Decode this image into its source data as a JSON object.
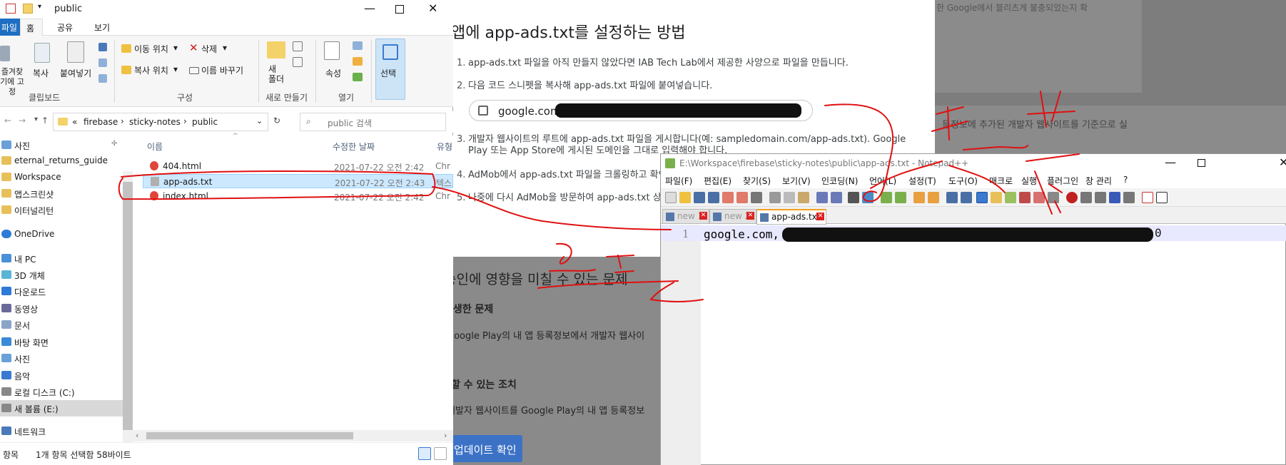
{
  "background_page": {
    "top_right_text": "한 Google에서 블리츠게 불충되었는지 확",
    "card2_text": "등정보에 추가된 개발자 웹사이트를 기준으로 실",
    "title": "앱에 app-ads.txt를 설정하는 방법",
    "steps": [
      {
        "num": "1.",
        "text": "app-ads.txt 파일을 아직 만들지 않았다면 IAB Tech Lab에서 제공한 사양으로 파일을 만듭니다."
      },
      {
        "num": "2.",
        "text": "다음 코드 스니펫을 복사해 app-ads.txt 파일에 붙여넣습니다."
      },
      {
        "num": "3.",
        "text": "개발자 웹사이트의 루트에 app-ads.txt 파일을 게시합니다(예: sampledomain.com/app-ads.txt). Google"
      },
      {
        "num": "",
        "text": "Play 또는 App Store에 게시된 도메인을 그대로 입력해야 합니다."
      },
      {
        "num": "4.",
        "text": "AdMob에서 app-ads.txt 파일을 크롤링하고 확인"
      },
      {
        "num": "5.",
        "text": "나중에 다시 AdMob을 방문하여 app-ads.txt 상태"
      }
    ],
    "snippet_text": "google.com,",
    "issues_heading": "승인에 영향을 미칠 수 있는 문제",
    "occurred_label": "발생한 문제",
    "occurred_text": "Google Play의 내 앱 등록정보에서 개발자 웹사이",
    "action_label": "할 수 있는 조치",
    "action_text": "개발자 웹사이트를 Google Play의 내 앱 등록정보",
    "update_button": "업데이트 확인"
  },
  "explorer": {
    "title": "public",
    "tabs": [
      "파일",
      "홈",
      "공유",
      "보기"
    ],
    "ribbon": {
      "pin_label": "즐겨찾기에 고정",
      "copy": "복사",
      "paste": "붙여넣기",
      "group_clipboard": "클립보드",
      "move_to": "이동 위치",
      "copy_to": "복사 위치",
      "delete": "삭제",
      "rename": "이름 바꾸기",
      "group_organize": "구성",
      "new_folder": "새 폴더",
      "group_new": "새로 만들기",
      "properties": "속성",
      "group_open": "열기",
      "select": "선택"
    },
    "breadcrumb": [
      "«",
      "firebase",
      "›",
      "sticky-notes",
      "›",
      "public"
    ],
    "search_placeholder": "public 검색",
    "nav_items": [
      {
        "label": "사진",
        "color": "#6aa0d8"
      },
      {
        "label": "eternal_returns_guide",
        "color": "#e8c05a"
      },
      {
        "label": "Workspace",
        "color": "#e8c05a"
      },
      {
        "label": "앱스크린샷",
        "color": "#e8c05a"
      },
      {
        "label": "이터널리턴",
        "color": "#e8c05a"
      },
      {
        "label": "OneDrive",
        "color": "#2d7bd6"
      },
      {
        "label": "내 PC",
        "color": "#4a90d9"
      },
      {
        "label": "3D 개체",
        "color": "#5ab4d6"
      },
      {
        "label": "다운로드",
        "color": "#2d7bd6"
      },
      {
        "label": "동영상",
        "color": "#6a6a9a"
      },
      {
        "label": "문서",
        "color": "#8aa4c8"
      },
      {
        "label": "바탕 화면",
        "color": "#3a8ad8"
      },
      {
        "label": "사진",
        "color": "#6aa0d8"
      },
      {
        "label": "음악",
        "color": "#3a7ad0"
      },
      {
        "label": "로컬 디스크 (C:)",
        "color": "#888888"
      },
      {
        "label": "새 볼륨 (E:)",
        "color": "#888888"
      },
      {
        "label": "네트워크",
        "color": "#4a7ab8"
      }
    ],
    "columns": [
      "이름",
      "수정한 날짜",
      "유형"
    ],
    "files": [
      {
        "name": "404.html",
        "date": "2021-07-22 오전 2:42",
        "type": "Chr",
        "icon_color": "#e0453a",
        "selected": false
      },
      {
        "name": "app-ads.txt",
        "date": "2021-07-22 오전 2:43",
        "type": "텍스",
        "icon_color": "#b0b0b0",
        "selected": true
      },
      {
        "name": "index.html",
        "date": "2021-07-22 오전 2:42",
        "type": "Chr",
        "icon_color": "#e0453a",
        "selected": false
      }
    ],
    "status_left": "항목",
    "status_text": "1개 항목 선택함 58바이트"
  },
  "notepad": {
    "title": "E:\\Workspace\\firebase\\sticky-notes\\public\\app-ads.txt - Notepad++",
    "menu": [
      "파일(F)",
      "편집(E)",
      "찾기(S)",
      "보기(V)",
      "인코딩(N)",
      "언어(L)",
      "설정(T)",
      "도구(O)",
      "매크로",
      "실행",
      "플러그인",
      "창 관리",
      "?"
    ],
    "tabs": [
      "new 1",
      "new 2",
      "app-ads.txt"
    ],
    "line_number": "1",
    "code_line": "google.com, pub-",
    "code_tail": "0"
  },
  "colors": {
    "accent": "#1e6fc1",
    "selection": "#cce8ff",
    "ink": "#e01010",
    "update_button": "#3c72c6"
  }
}
